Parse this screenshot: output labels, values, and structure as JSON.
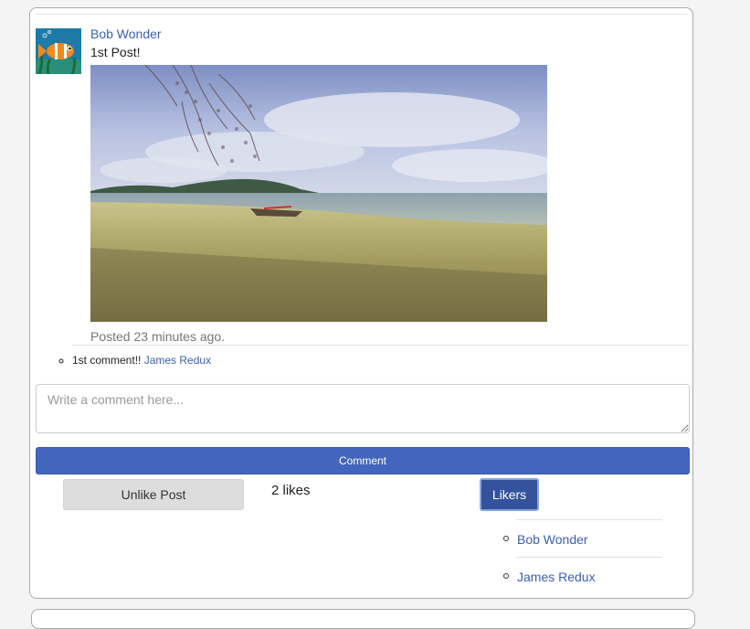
{
  "post": {
    "author": "Bob Wonder",
    "text": "1st Post!",
    "posted": "Posted 23 minutes ago.",
    "avatar_icon": "fish-avatar-icon",
    "photo_description_icon": "beach-photo"
  },
  "comments": [
    {
      "text": "1st comment!!",
      "author": "James Redux"
    }
  ],
  "comment_form": {
    "placeholder": "Write a comment here...",
    "submit_label": "Comment"
  },
  "likes": {
    "unlike_label": "Unlike Post",
    "count_label": "2 likes",
    "likers_label": "Likers",
    "likers": [
      "Bob Wonder",
      "James Redux"
    ]
  },
  "colors": {
    "accent": "#4266bd",
    "link": "#3b5fb0",
    "likers_button": "#34539c"
  }
}
